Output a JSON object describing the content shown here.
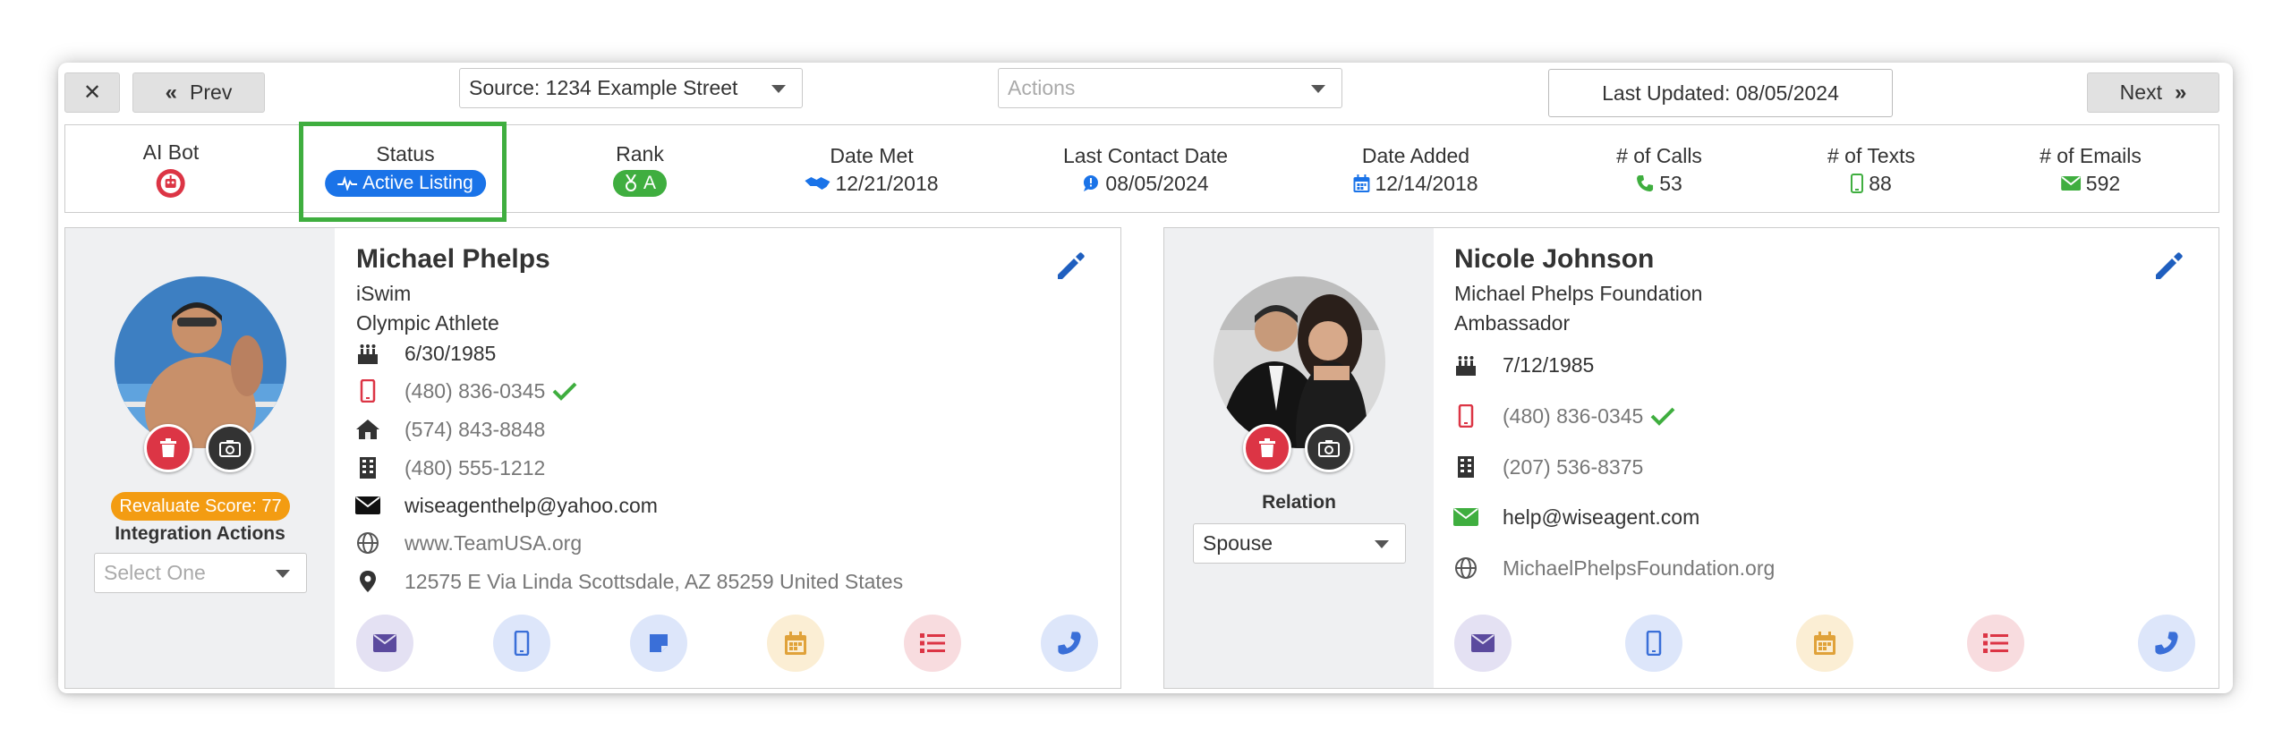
{
  "toolbar": {
    "close_label": "✕",
    "prev_label": "Prev",
    "next_label": "Next",
    "source_select": "Source: 1234 Example Street",
    "actions_placeholder": "Actions",
    "last_updated": "Last Updated: 08/05/2024"
  },
  "stats": {
    "ai_bot": {
      "label": "AI Bot"
    },
    "status": {
      "label": "Status",
      "value": "Active Listing"
    },
    "rank": {
      "label": "Rank",
      "value": "A"
    },
    "date_met": {
      "label": "Date Met",
      "value": "12/21/2018"
    },
    "last_contact": {
      "label": "Last Contact Date",
      "value": "08/05/2024"
    },
    "date_added": {
      "label": "Date Added",
      "value": "12/14/2018"
    },
    "calls": {
      "label": "# of Calls",
      "value": "53"
    },
    "texts": {
      "label": "# of Texts",
      "value": "88"
    },
    "emails": {
      "label": "# of Emails",
      "value": "592"
    }
  },
  "primary": {
    "name": "Michael Phelps",
    "company": "iSwim",
    "title": "Olympic Athlete",
    "birthday": "6/30/1985",
    "mobile": "(480) 836-0345",
    "home": "(574) 843-8848",
    "work": "(480) 555-1212",
    "email": "wiseagenthelp@yahoo.com",
    "website": "www.TeamUSA.org",
    "address": "12575 E Via Linda Scottsdale, AZ 85259 United States",
    "revaluate": "Revaluate Score: 77",
    "integration_label": "Integration Actions",
    "integration_placeholder": "Select One"
  },
  "secondary": {
    "name": "Nicole Johnson",
    "company": "Michael Phelps Foundation",
    "title": "Ambassador",
    "birthday": "7/12/1985",
    "mobile": "(480) 836-0345",
    "work": "(207) 536-8375",
    "email": "help@wiseagent.com",
    "website": "MichaelPhelpsFoundation.org",
    "relation_label": "Relation",
    "relation_value": "Spouse"
  },
  "colors": {
    "status_blue": "#1a73e8",
    "rank_green": "#3fae3f",
    "revaluate_orange": "#f39c12",
    "highlight_green": "#3fae3f",
    "delete_red": "#dc3545",
    "edit_blue": "#1f5fbf"
  }
}
